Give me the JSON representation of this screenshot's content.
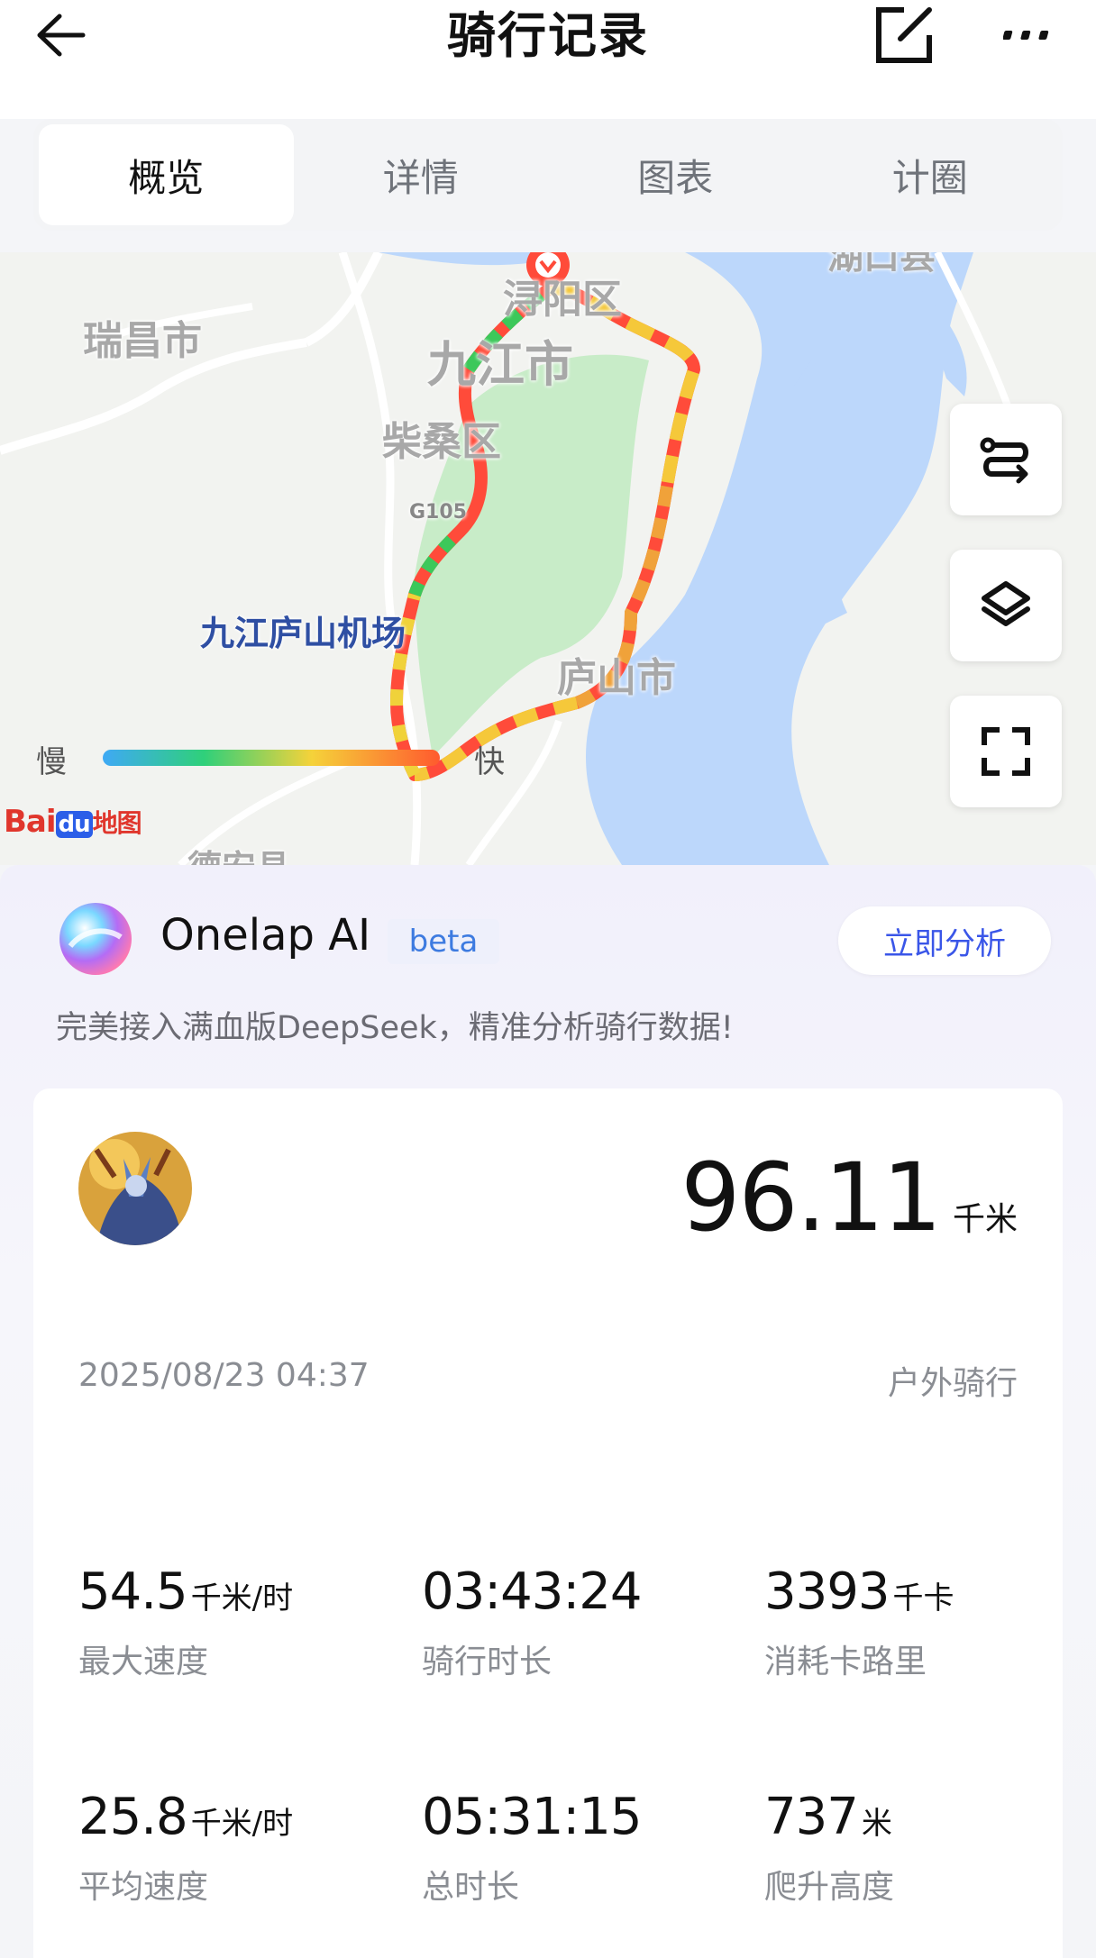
{
  "header": {
    "title": "骑行记录",
    "back_icon": "arrow-left-icon",
    "edit_icon": "edit-icon",
    "more_icon": "more-icon"
  },
  "tabs": [
    {
      "label": "概览",
      "active": true
    },
    {
      "label": "详情",
      "active": false
    },
    {
      "label": "图表",
      "active": false
    },
    {
      "label": "计圈",
      "active": false
    }
  ],
  "map": {
    "labels": {
      "ruichang": "瑞昌市",
      "jiujiang": "九江市",
      "chaisang": "柴桑区",
      "airport": "九江庐山机场",
      "lushan": "庐山市",
      "xunyang": "浔阳区",
      "hukou": "湖口县",
      "road": "G105",
      "dean": "德安县"
    },
    "legend": {
      "slow": "慢",
      "fast": "快"
    },
    "provider": "Bai du 地图",
    "controls": [
      "route-icon",
      "layers-icon",
      "fullscreen-icon"
    ]
  },
  "ai": {
    "title": "Onelap AI",
    "badge": "beta",
    "button": "立即分析",
    "description": "完美接入满血版DeepSeek，精准分析骑行数据!"
  },
  "summary": {
    "distance": "96.11",
    "distance_unit": "千米",
    "date": "2025/08/23 04:37",
    "type": "户外骑行"
  },
  "stats": [
    {
      "value": "54.5",
      "unit": "千米/时",
      "label": "最大速度"
    },
    {
      "value": "03:43:24",
      "unit": "",
      "label": "骑行时长"
    },
    {
      "value": "3393",
      "unit": "千卡",
      "label": "消耗卡路里"
    },
    {
      "value": "25.8",
      "unit": "千米/时",
      "label": "平均速度"
    },
    {
      "value": "05:31:15",
      "unit": "",
      "label": "总时长"
    },
    {
      "value": "737",
      "unit": "米",
      "label": "爬升高度"
    }
  ],
  "colors": {
    "accent": "#3a56e8",
    "beta": "#3d7be0",
    "route_fast": "#ff4b3a",
    "route_mid": "#f5c83a",
    "route_slow": "#3cc85a",
    "park": "#c8ecc8",
    "water": "#bcd7fb"
  }
}
